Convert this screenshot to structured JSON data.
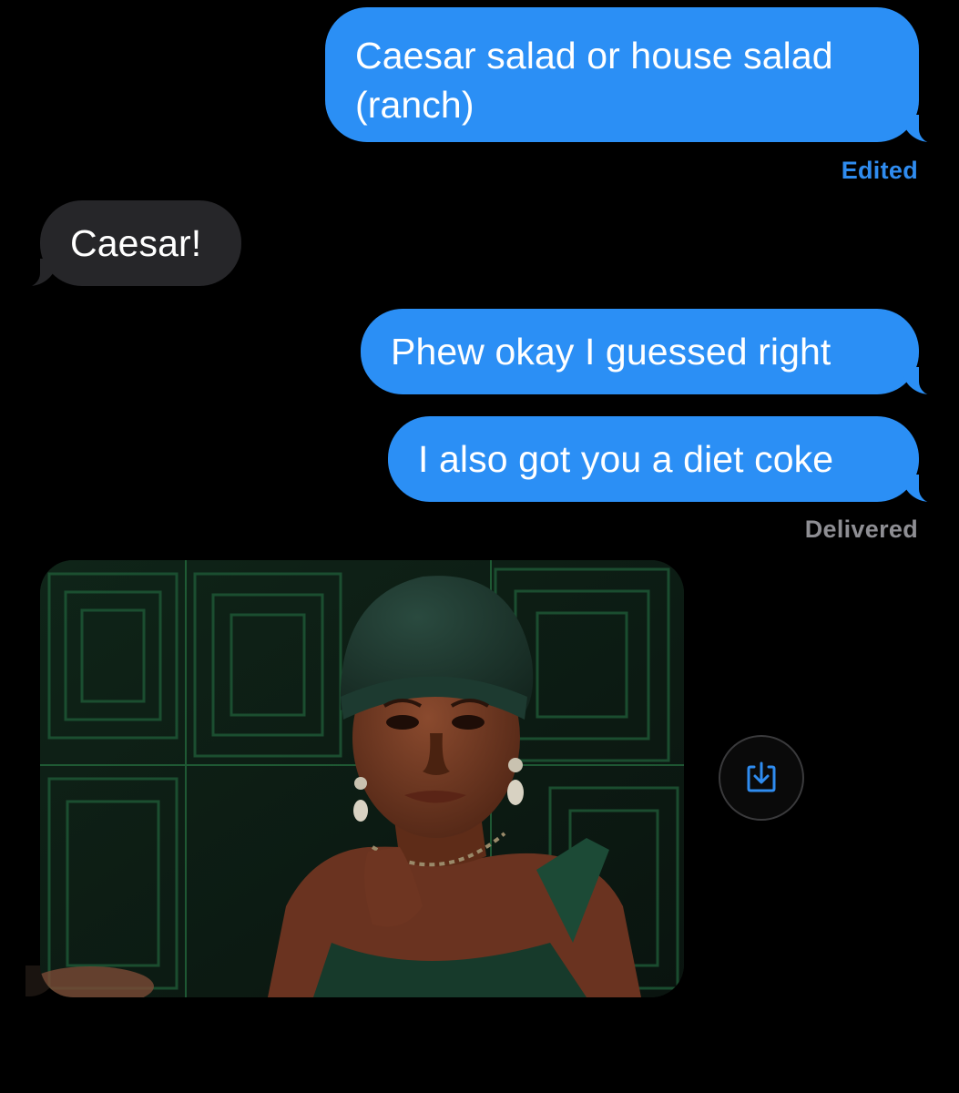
{
  "messages": [
    {
      "id": "m1",
      "direction": "sent",
      "lines": [
        "Caesar salad or house salad",
        "(ranch)"
      ]
    },
    {
      "id": "m2",
      "direction": "received",
      "text": "Caesar!"
    },
    {
      "id": "m3",
      "direction": "sent",
      "text": "Phew okay I guessed right"
    },
    {
      "id": "m4",
      "direction": "sent",
      "text": "I also got you a diet coke"
    },
    {
      "id": "m5",
      "direction": "received",
      "type": "image",
      "alt_icon": "reaction-gif-image"
    }
  ],
  "status": {
    "edited": "Edited",
    "delivered": "Delivered"
  },
  "icons": {
    "save": "save-to-photos-icon"
  },
  "colors": {
    "sent_bubble": "#2b8ff5",
    "received_bubble": "#262629",
    "edited_label": "#2f8cf0",
    "delivered_label": "#8e8e93",
    "background": "#000000"
  }
}
